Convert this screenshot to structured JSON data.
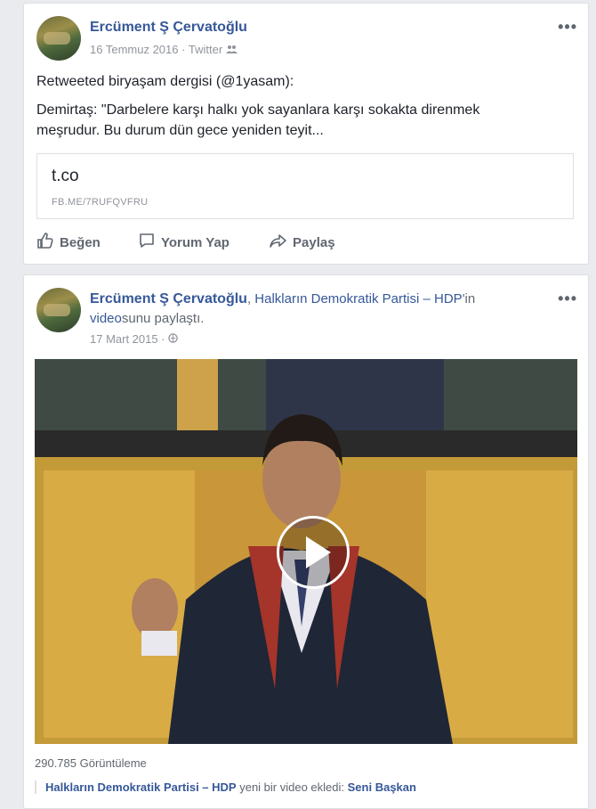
{
  "post1": {
    "author": "Ercüment Ş Çervatoğlu",
    "date": "16 Temmuz 2016",
    "source": "Twitter",
    "retweet_line": "Retweeted biryaşam dergisi (@1yasam):",
    "quote_line1": "Demirtaş: \"Darbelere karşı halkı yok sayanlara karşı sokakta direnmek",
    "quote_line2": "meşrudur. Bu durum dün gece yeniden teyit...",
    "link_title": "t.co",
    "link_url": "FB.ME/7RUFQVFRU",
    "actions": {
      "like": "Beğen",
      "comment": "Yorum Yap",
      "share": "Paylaş"
    }
  },
  "post2": {
    "author": "Ercüment Ş Çervatoğlu",
    "page_name": "Halkların Demokratik Partisi – HDP",
    "share_suffix": "'in",
    "share_word_video": "video",
    "share_word_rest": "sunu paylaştı.",
    "date": "17 Mart 2015",
    "views": "290.785 Görüntüleme",
    "shared_page": "Halkların Demokratik Partisi – HDP",
    "shared_text": "yeni bir video ekledi:",
    "shared_title": "Seni Başkan"
  },
  "ui": {
    "more": "•••",
    "dot": "·",
    "accent": "#365899"
  }
}
